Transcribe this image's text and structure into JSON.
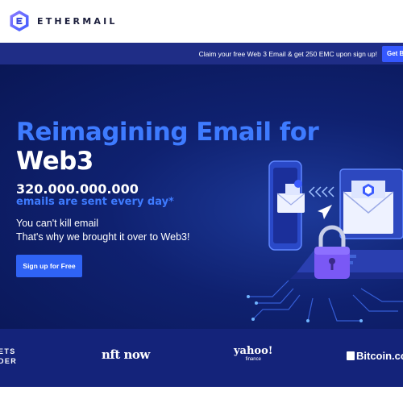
{
  "header": {
    "logo_text": "ETHERMAIL",
    "logo_icon": "ethermail-hexagon-logo"
  },
  "banner": {
    "text": "Claim your free Web 3 Email & get 250 EMC upon sign up!",
    "button_label": "Get Be"
  },
  "hero": {
    "title_line_1": "Reimagining Email for",
    "title_line_2": "Web3",
    "stat_number": "320.000.000.000",
    "stat_caption": "emails are sent every day*",
    "subtext_line_1": "You can't kill email",
    "subtext_line_2": "That's why we brought it over to Web3!",
    "cta_label": "Sign up for Free",
    "illustration": "phone-laptop-email-padlock-illustration"
  },
  "partners": {
    "markets_line_1": "ETS",
    "markets_line_2": "DER",
    "nftnow": "nft now",
    "yahoo": "yahoo!",
    "yahoo_sub": "finance",
    "bitcoin": "Bitcoin.co"
  },
  "colors": {
    "hero_bg": "#0f2170",
    "accent_blue": "#3e7bff",
    "banner_bg": "#1f2d86",
    "cta_bg": "#2f63f5",
    "partners_bg": "#14237a"
  }
}
